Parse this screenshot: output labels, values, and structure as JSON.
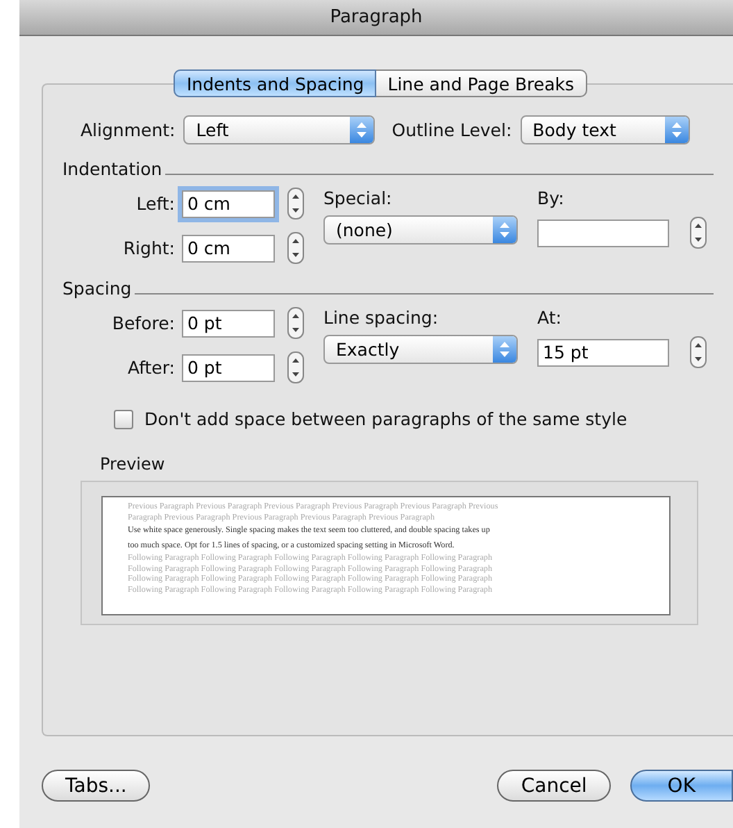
{
  "window": {
    "title": "Paragraph"
  },
  "tabs": [
    {
      "label": "Indents and Spacing",
      "selected": true
    },
    {
      "label": "Line and Page Breaks",
      "selected": false
    }
  ],
  "alignment": {
    "label": "Alignment:",
    "value": "Left"
  },
  "outline_level": {
    "label": "Outline Level:",
    "value": "Body text"
  },
  "indentation": {
    "title": "Indentation",
    "fields": [
      {
        "label": "Left:",
        "value": "0 cm",
        "focused": true
      },
      {
        "label": "Right:",
        "value": "0 cm",
        "focused": false
      }
    ],
    "special": {
      "label": "Special:",
      "value": "(none)"
    },
    "by": {
      "label": "By:"
    }
  },
  "spacing": {
    "title": "Spacing",
    "fields": [
      {
        "label": "Before:",
        "value": "0 pt",
        "focused": false
      },
      {
        "label": "After:",
        "value": "0 pt",
        "focused": false
      }
    ],
    "line_spacing": {
      "label": "Line spacing:",
      "value": "Exactly"
    },
    "at": {
      "label": "At:",
      "value": "15 pt"
    }
  },
  "no_space_checkbox": {
    "label": "Don't add space between paragraphs of the same style",
    "checked": false
  },
  "preview": {
    "title": "Preview",
    "previous": [
      "Previous Paragraph Previous Paragraph Previous Paragraph Previous Paragraph Previous Paragraph Previous",
      "Paragraph Previous Paragraph Previous Paragraph Previous Paragraph Previous Paragraph"
    ],
    "current": [
      "Use white space generously. Single spacing makes the text seem too cluttered, and double spacing takes up",
      "too much space. Opt for 1.5 lines of spacing, or a customized spacing setting in Microsoft Word."
    ],
    "following": [
      "Following Paragraph Following Paragraph Following Paragraph Following Paragraph Following Paragraph",
      "Following Paragraph Following Paragraph Following Paragraph Following Paragraph Following Paragraph",
      "Following Paragraph Following Paragraph Following Paragraph Following Paragraph Following Paragraph",
      "Following Paragraph Following Paragraph Following Paragraph Following Paragraph Following Paragraph"
    ]
  },
  "buttons": [
    {
      "label": "Tabs...",
      "kind": "normal"
    },
    {
      "label": "Cancel",
      "kind": "normal"
    },
    {
      "label": "OK",
      "kind": "default"
    }
  ]
}
